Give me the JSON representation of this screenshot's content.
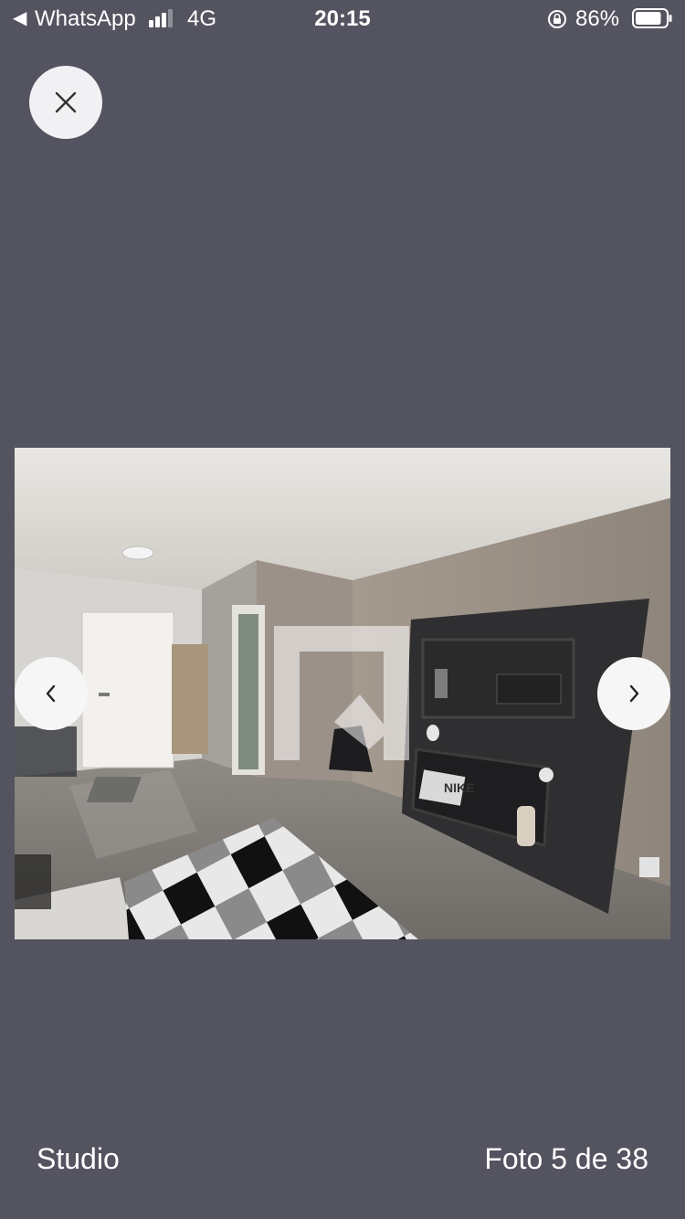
{
  "status_bar": {
    "back_app": "WhatsApp",
    "network": "4G",
    "time": "20:15",
    "battery_percent": "86%",
    "signal_bars": 3,
    "battery_level": 0.86
  },
  "viewer": {
    "close_icon": "close-icon",
    "prev_icon": "chevron-left-icon",
    "next_icon": "chevron-right-icon",
    "photo_description_icon": "studio-room-photo",
    "watermark_icon": "brand-logo-watermark",
    "photo_box_label": "NIKE"
  },
  "caption": {
    "title": "Studio",
    "counter": "Foto 5 de 38"
  },
  "colors": {
    "background": "#545461",
    "button_fill": "#f1f1f3",
    "text": "#ffffff"
  }
}
